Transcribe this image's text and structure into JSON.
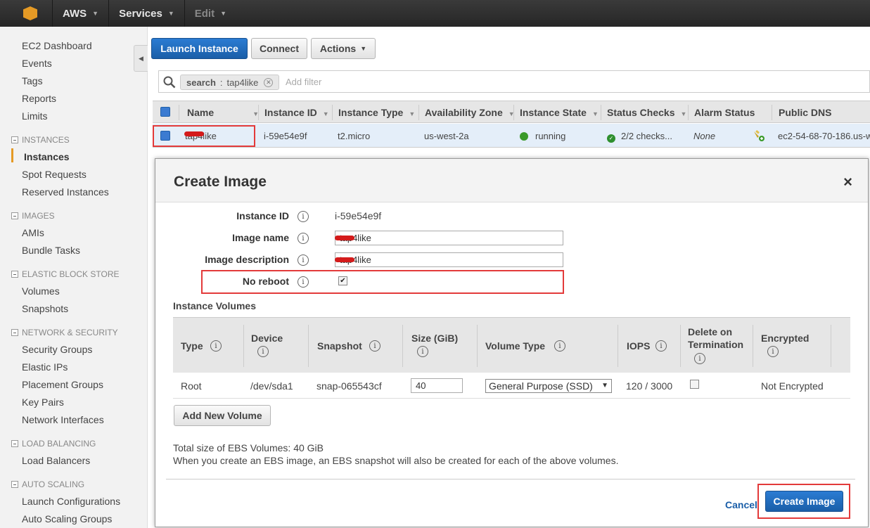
{
  "topbar": {
    "brand": "AWS",
    "services": "Services",
    "edit": "Edit"
  },
  "sidebar": {
    "items": [
      "EC2 Dashboard",
      "Events",
      "Tags",
      "Reports",
      "Limits"
    ],
    "instances_section": "INSTANCES",
    "instances_items": [
      "Instances",
      "Spot Requests",
      "Reserved Instances"
    ],
    "images_section": "IMAGES",
    "images_items": [
      "AMIs",
      "Bundle Tasks"
    ],
    "ebs_section": "ELASTIC BLOCK STORE",
    "ebs_items": [
      "Volumes",
      "Snapshots"
    ],
    "network_section": "NETWORK & SECURITY",
    "network_items": [
      "Security Groups",
      "Elastic IPs",
      "Placement Groups",
      "Key Pairs",
      "Network Interfaces"
    ],
    "lb_section": "LOAD BALANCING",
    "lb_items": [
      "Load Balancers"
    ],
    "as_section": "AUTO SCALING",
    "as_items": [
      "Launch Configurations",
      "Auto Scaling Groups"
    ]
  },
  "toolbar": {
    "launch": "Launch Instance",
    "connect": "Connect",
    "actions": "Actions"
  },
  "filter": {
    "key": "search",
    "sep": ":",
    "value": "tap4like",
    "placeholder": "Add filter"
  },
  "grid": {
    "headers": [
      "Name",
      "Instance ID",
      "Instance Type",
      "Availability Zone",
      "Instance State",
      "Status Checks",
      "Alarm Status",
      "Public DNS"
    ],
    "row": {
      "name": "tap4like",
      "instance_id": "i-59e54e9f",
      "type": "t2.micro",
      "zone": "us-west-2a",
      "state": "running",
      "checks": "2/2 checks...",
      "alarm": "None",
      "dns": "ec2-54-68-70-186.us-w"
    }
  },
  "modal": {
    "title": "Create Image",
    "close": "×",
    "fields": {
      "instance_id_label": "Instance ID",
      "instance_id_value": "i-59e54e9f",
      "image_name_label": "Image name",
      "image_name_value": "tap4like",
      "image_desc_label": "Image description",
      "image_desc_value": "tap4like",
      "no_reboot_label": "No reboot",
      "no_reboot_checked": true
    },
    "volumes_title": "Instance Volumes",
    "volume_headers": {
      "type": "Type",
      "device": "Device",
      "snapshot": "Snapshot",
      "size": "Size (GiB)",
      "volume_type": "Volume Type",
      "iops": "IOPS",
      "delete_on_termination_1": "Delete on",
      "delete_on_termination_2": "Termination",
      "encrypted": "Encrypted"
    },
    "volume_row": {
      "type": "Root",
      "device": "/dev/sda1",
      "snapshot": "snap-065543cf",
      "size": "40",
      "volume_type": "General Purpose (SSD)",
      "iops": "120 / 3000",
      "encrypted": "Not Encrypted"
    },
    "add_volume": "Add New Volume",
    "total_size": "Total size of EBS Volumes: 40 GiB",
    "note": "When you create an EBS image, an EBS snapshot will also be created for each of the above volumes.",
    "cancel": "Cancel",
    "create": "Create Image"
  },
  "colors": {
    "accent": "#e59a25",
    "primary_button": "#1a5ea8",
    "highlight_box": "#e33a3a",
    "running": "#3a9a2a"
  }
}
